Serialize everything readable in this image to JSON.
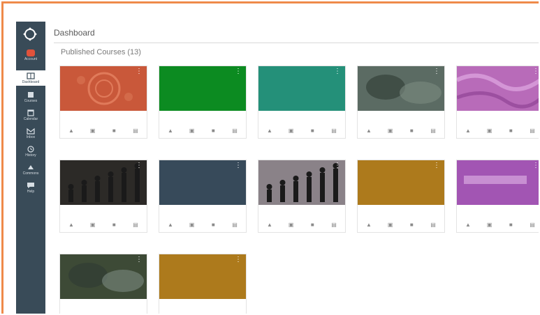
{
  "header": {
    "title": "Dashboard"
  },
  "section": {
    "title": "Published Courses (13)"
  },
  "sidebar": {
    "items": [
      {
        "label": "Account",
        "icon": "avatar-icon"
      },
      {
        "label": "Dashboard",
        "icon": "dashboard-icon"
      },
      {
        "label": "Courses",
        "icon": "book-icon"
      },
      {
        "label": "Calendar",
        "icon": "calendar-icon"
      },
      {
        "label": "Inbox",
        "icon": "inbox-icon"
      },
      {
        "label": "History",
        "icon": "clock-icon"
      },
      {
        "label": "Commons",
        "icon": "commons-icon"
      },
      {
        "label": "Help",
        "icon": "help-icon"
      }
    ]
  },
  "colors": {
    "sidebar": "#394b58",
    "accent_border": "#ef8a4a"
  },
  "cards": [
    {
      "name": "",
      "term": "",
      "color": "#c9583a",
      "image": "pattern"
    },
    {
      "name": "",
      "term": "",
      "color": "#0c8b21"
    },
    {
      "name": "",
      "term": "",
      "color": "#249079"
    },
    {
      "name": "",
      "term": "",
      "color": "#5b6b63",
      "image": "photo"
    },
    {
      "name": "",
      "term": "",
      "color": "#b86bb9",
      "image": "texture"
    },
    {
      "name": "",
      "term": "",
      "color": "#2c2a27",
      "image": "silhouettes"
    },
    {
      "name": "",
      "term": "",
      "color": "#374a5a"
    },
    {
      "name": "",
      "term": "",
      "color": "#8a8288",
      "image": "silhouettes"
    },
    {
      "name": "",
      "term": "",
      "color": "#ad7a1c"
    },
    {
      "name": "",
      "term": "",
      "color": "#a255b3",
      "image": "text"
    },
    {
      "name": "",
      "term": "",
      "color": "#3d4a36",
      "image": "photo"
    },
    {
      "name": "",
      "term": "",
      "color": "#ad7a1c"
    }
  ],
  "card_actions": [
    "announcements-icon",
    "assignments-icon",
    "discussions-icon",
    "files-icon"
  ]
}
